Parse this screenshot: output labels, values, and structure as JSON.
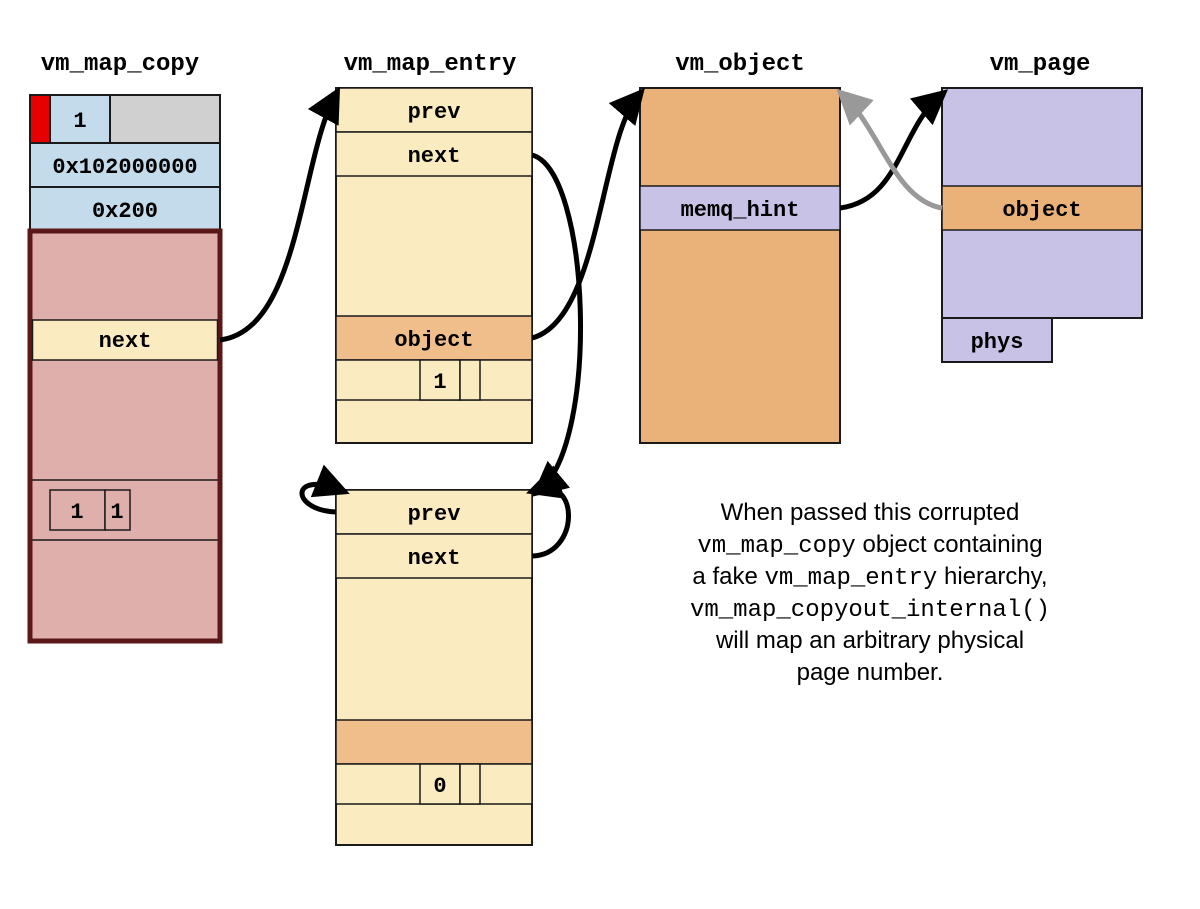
{
  "titles": {
    "vm_map_copy": "vm_map_copy",
    "vm_map_entry": "vm_map_entry",
    "vm_object": "vm_object",
    "vm_page": "vm_page"
  },
  "vm_map_copy": {
    "type_value": "1",
    "addr": "0x102000000",
    "size": "0x200",
    "header_next": "next",
    "flags_a": "1",
    "flags_b": "1"
  },
  "vm_map_entry1": {
    "prev": "prev",
    "next": "next",
    "object_label": "object",
    "flag": "1"
  },
  "vm_map_entry2": {
    "prev": "prev",
    "next": "next",
    "flag": "0"
  },
  "vm_object": {
    "memq_hint": "memq_hint"
  },
  "vm_page": {
    "object": "object",
    "phys": "phys"
  },
  "caption": {
    "l1a": "When passed this corrupted",
    "l2a": "vm_map_copy",
    "l2b": " object containing",
    "l3a": "a fake ",
    "l3b": "vm_map_entry",
    "l3c": " hierarchy,",
    "l4": "vm_map_copyout_internal()",
    "l5": "will map an arbitrary physical",
    "l6": "page number."
  },
  "colors": {
    "blue": "#c3dbeb",
    "red": "#e60000",
    "grey": "#d0d0d0",
    "pink": "#deafab",
    "pinkbd": "#5c1818",
    "cream": "#fbebc0",
    "orange": "#f0be8b",
    "darkor": "#eab178",
    "lilac": "#c8c2e6",
    "stroke": "#1a1a1a"
  }
}
